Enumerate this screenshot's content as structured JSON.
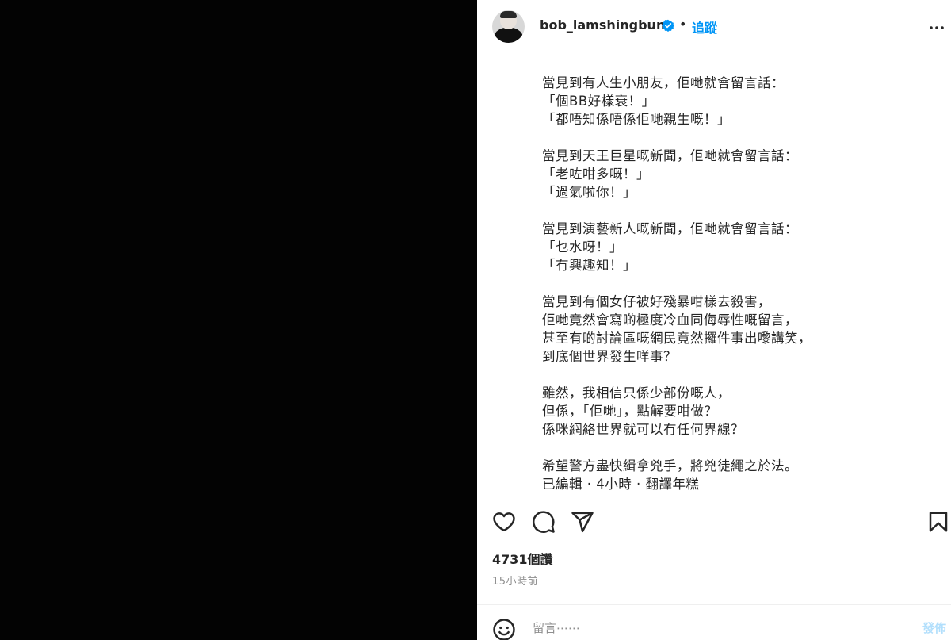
{
  "header": {
    "username": "bob_lamshingbun",
    "separator": "•",
    "follow_label": "追蹤"
  },
  "caption": {
    "text": "當見到有人生小朋友，佢哋就會留言話：\n「個BB好樣衰！」\n「都唔知係唔係佢哋親生嘅！」\n\n當見到天王巨星嘅新聞，佢哋就會留言話：\n「老咗咁多嘅！」\n「過氣啦你！」\n\n當見到演藝新人嘅新聞，佢哋就會留言話：\n「乜水呀！」\n「冇興趣知！」\n\n當見到有個女仔被好殘暴咁樣去殺害，\n佢哋竟然會寫啲極度冷血同侮辱性嘅留言，\n甚至有啲討論區嘅網民竟然攞件事出嚟講笑，\n到底個世界發生咩事？\n\n雖然，我相信只係少部份嘅人，\n但係，「佢哋」，點解要咁做？\n係咪網絡世界就可以冇任何界線？\n\n希望警方盡快緝拿兇手，將兇徒繩之於法。\n已編輯 · 4小時 · 翻譯年糕"
  },
  "stats": {
    "likes": "4731個讚",
    "time": "15小時前"
  },
  "comment": {
    "placeholder": "留言⋯⋯",
    "post_label": "發佈"
  },
  "icons": {
    "verified": "verified-badge-icon",
    "more": "more-options-icon",
    "like": "heart-icon",
    "comment": "comment-icon",
    "share": "share-icon",
    "save": "bookmark-icon",
    "emoji": "emoji-icon"
  },
  "colors": {
    "accent": "#0095f6",
    "verified": "#0095f6",
    "post_disabled": "#b2dffc",
    "media_bg": "#030303"
  }
}
